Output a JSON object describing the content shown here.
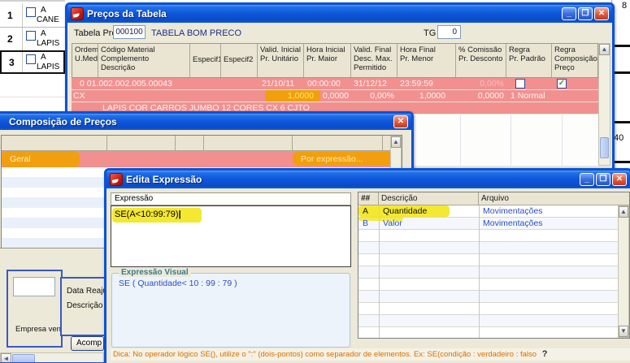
{
  "background": {
    "left_grid": {
      "rows": [
        {
          "num": "1",
          "tipo": "A",
          "nome": "CANE"
        },
        {
          "num": "2",
          "tipo": "A",
          "nome": "LAPIS"
        },
        {
          "num": "3",
          "tipo": "A",
          "nome": "LAPIS"
        }
      ]
    },
    "right_strip": {
      "v1": "8",
      "v2": "40"
    },
    "bottom_panel": {
      "empresa_label": "Empresa venc",
      "data_label": "Data Reaju",
      "descricao_label": "Descrição",
      "acomp_button": "Acomp"
    }
  },
  "precos_window": {
    "title": "Preços da Tabela",
    "buttons": {
      "minimize": "_",
      "maximize": "❐",
      "close": "✕"
    },
    "tabela_preco_label": "Tabela Preço",
    "tabela_preco_value": "000100",
    "tabela_nome": "TABELA BOM PRECO",
    "tg_label": "TG",
    "tg_value": "0",
    "grid": {
      "headers": [
        "Ordem\nU.Med.",
        "Código Material\nComplemento\nDescrição",
        "Especif1",
        "Especif2",
        "Valid. Inicial\nPr. Unitário",
        "Hora Inicial\nPr. Maior",
        "Valid. Final\nDesc. Max.\nPermitido",
        "Hora Final\nPr. Menor",
        "% Comissão\nPr. Desconto",
        "Regra\nPr. Padrão",
        "Regra\nComposição\nPreço"
      ],
      "row1": {
        "ordem_codigo": "0  01.002.002.005.00043",
        "valid_inicial": "21/10/11",
        "hora_inicial": "00:00:00",
        "valid_final": "31/12/12",
        "hora_final": "23:59:59",
        "comissao": "0,00%"
      },
      "row2": {
        "umed": "CX",
        "pr_unitario": "1,0000",
        "pr_maior": "0,0000",
        "desc_max": "0,00%",
        "pr_menor": "1,0000",
        "pr_desconto": "0,0000",
        "regra": "1 Normal"
      },
      "row3": {
        "descricao": "LAPIS COR CARROS JUMBO 12 CORES CX 6 CJTO"
      }
    }
  },
  "composicao_window": {
    "title": "Composição de Preços",
    "close_button": "✕",
    "row": {
      "geral": "Geral",
      "por_expressao": "Por expressão..."
    }
  },
  "edita_window": {
    "title": "Edita Expressão",
    "buttons": {
      "minimize": "_",
      "maximize": "❐",
      "close": "✕"
    },
    "expressao_header": "Expressão",
    "expressao_value": "SE(A<10:99:79)",
    "cursor": "|",
    "visual_label": "Expressão Visual",
    "visual_value": "SE ( Quantidade< 10 : 99 : 79 )",
    "grid": {
      "headers": {
        "id": "##",
        "descricao": "Descrição",
        "arquivo": "Arquivo"
      },
      "rows": [
        {
          "id": "A",
          "descricao": "Quantidade",
          "arquivo": "Movimentações"
        },
        {
          "id": "B",
          "descricao": "Valor",
          "arquivo": "Movimentações"
        }
      ]
    },
    "hint": "Dica: No operador lógico SE(), utilize o \":\" (dois-pontos) como separador de elementos. Ex: SE(condição : verdadeiro : falso",
    "help": "?"
  },
  "colors": {
    "titlebar_blue": "#0f58dc",
    "pink_row": "#f29090",
    "marker_orange": "#f0a007",
    "marker_yellow": "#f2e40c",
    "beige": "#ece9d8",
    "hint_orange": "#d96e00",
    "link_blue": "#2b4fc4"
  }
}
